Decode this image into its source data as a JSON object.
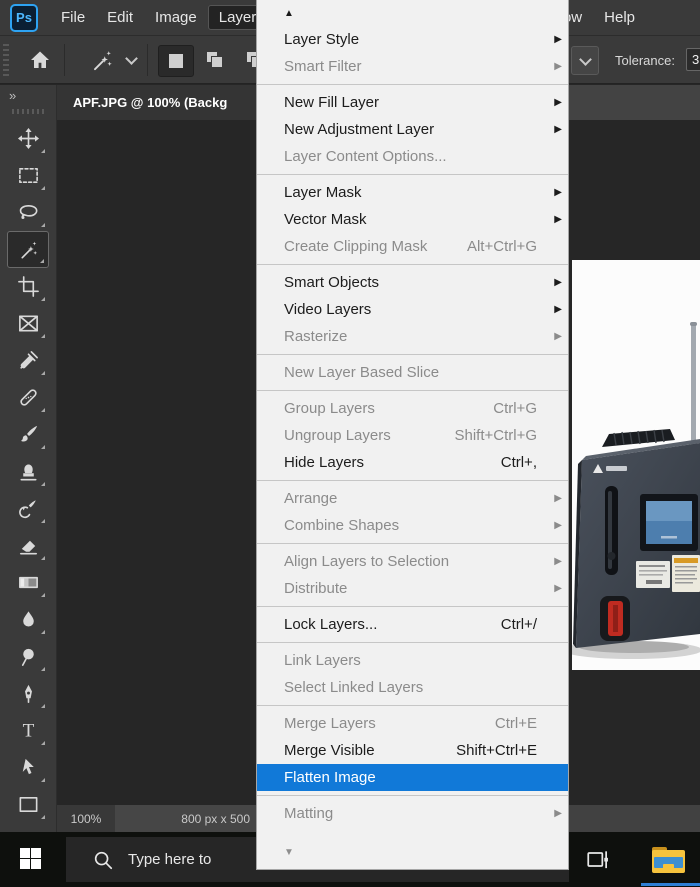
{
  "colors": {
    "menu_highlight": "#1179d8",
    "ps_logo_blue": "#2ea3f2",
    "taskbar_active_underline": "#2f7fd4"
  },
  "menubar": {
    "logo_text": "Ps",
    "items": [
      {
        "label": "File",
        "active": false
      },
      {
        "label": "Edit",
        "active": false
      },
      {
        "label": "Image",
        "active": false
      },
      {
        "label": "Layer",
        "active": true
      },
      {
        "label": "ow",
        "active": false
      },
      {
        "label": "Help",
        "active": false
      }
    ]
  },
  "options_bar": {
    "icons": [
      "home-icon",
      "magic-wand-icon",
      "wand-options-chevron-icon",
      "new-selection-icon",
      "add-to-selection-icon",
      "subtract-from-selection-icon",
      "dropdown-chevron-icon"
    ],
    "tolerance_label": "Tolerance:",
    "tolerance_value": "3"
  },
  "tab_bar": {
    "active_tab_title": "APF.JPG @ 100% (Backg"
  },
  "toolbar": {
    "expand_label": "»",
    "tools": [
      {
        "name": "move",
        "selected": false
      },
      {
        "name": "rectangular-marquee",
        "selected": false
      },
      {
        "name": "lasso",
        "selected": false
      },
      {
        "name": "magic-wand",
        "selected": true
      },
      {
        "name": "crop",
        "selected": false
      },
      {
        "name": "frame",
        "selected": false
      },
      {
        "name": "eyedropper",
        "selected": false
      },
      {
        "name": "spot-healing-brush",
        "selected": false
      },
      {
        "name": "brush",
        "selected": false
      },
      {
        "name": "clone-stamp",
        "selected": false
      },
      {
        "name": "history-brush",
        "selected": false
      },
      {
        "name": "eraser",
        "selected": false
      },
      {
        "name": "gradient",
        "selected": false
      },
      {
        "name": "blur",
        "selected": false
      },
      {
        "name": "dodge",
        "selected": false
      },
      {
        "name": "pen",
        "selected": false
      },
      {
        "name": "type",
        "selected": false
      },
      {
        "name": "path-selection",
        "selected": false
      },
      {
        "name": "rectangle",
        "selected": false
      }
    ]
  },
  "layer_menu": {
    "items": [
      {
        "label": "Layer Style",
        "submenu": true,
        "enabled": true
      },
      {
        "label": "Smart Filter",
        "submenu": true,
        "enabled": false
      },
      {
        "separator": true
      },
      {
        "label": "New Fill Layer",
        "submenu": true,
        "enabled": true
      },
      {
        "label": "New Adjustment Layer",
        "submenu": true,
        "enabled": true
      },
      {
        "label": "Layer Content Options...",
        "enabled": false
      },
      {
        "separator": true
      },
      {
        "label": "Layer Mask",
        "submenu": true,
        "enabled": true
      },
      {
        "label": "Vector Mask",
        "submenu": true,
        "enabled": true
      },
      {
        "label": "Create Clipping Mask",
        "shortcut": "Alt+Ctrl+G",
        "enabled": false
      },
      {
        "separator": true
      },
      {
        "label": "Smart Objects",
        "submenu": true,
        "enabled": true
      },
      {
        "label": "Video Layers",
        "submenu": true,
        "enabled": true
      },
      {
        "label": "Rasterize",
        "submenu": true,
        "enabled": false
      },
      {
        "separator": true
      },
      {
        "label": "New Layer Based Slice",
        "enabled": false
      },
      {
        "separator": true
      },
      {
        "label": "Group Layers",
        "shortcut": "Ctrl+G",
        "enabled": false
      },
      {
        "label": "Ungroup Layers",
        "shortcut": "Shift+Ctrl+G",
        "enabled": false
      },
      {
        "label": "Hide Layers",
        "shortcut": "Ctrl+,",
        "enabled": true
      },
      {
        "separator": true
      },
      {
        "label": "Arrange",
        "submenu": true,
        "enabled": false
      },
      {
        "label": "Combine Shapes",
        "submenu": true,
        "enabled": false
      },
      {
        "separator": true
      },
      {
        "label": "Align Layers to Selection",
        "submenu": true,
        "enabled": false
      },
      {
        "label": "Distribute",
        "submenu": true,
        "enabled": false
      },
      {
        "separator": true
      },
      {
        "label": "Lock Layers...",
        "shortcut": "Ctrl+/",
        "enabled": true
      },
      {
        "separator": true
      },
      {
        "label": "Link Layers",
        "enabled": false
      },
      {
        "label": "Select Linked Layers",
        "enabled": false
      },
      {
        "separator": true
      },
      {
        "label": "Merge Layers",
        "shortcut": "Ctrl+E",
        "enabled": false
      },
      {
        "label": "Merge Visible",
        "shortcut": "Shift+Ctrl+E",
        "enabled": true
      },
      {
        "label": "Flatten Image",
        "enabled": true,
        "highlighted": true
      },
      {
        "separator": true
      },
      {
        "label": "Matting",
        "submenu": true,
        "enabled": false
      }
    ]
  },
  "status_bar": {
    "zoom_level": "100%",
    "document_size": "800 px x 500"
  },
  "taskbar": {
    "search_placeholder": "Type here to"
  }
}
